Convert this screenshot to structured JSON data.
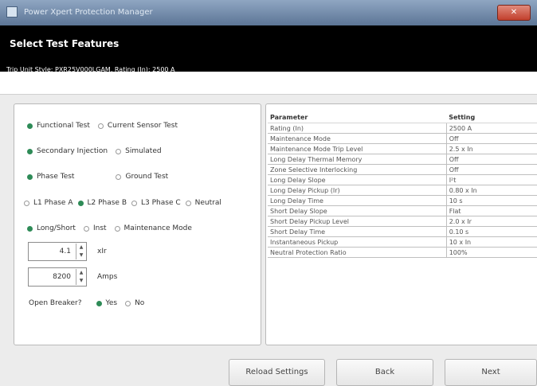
{
  "window": {
    "title": "Power Xpert Protection Manager",
    "close_glyph": "✕"
  },
  "header": {
    "title": "Select Test Features",
    "subtitle": "Trip Unit Style: PXR25V000LGAM, Rating (In): 2500 A"
  },
  "test_options": {
    "mode": {
      "options": [
        "Functional Test",
        "Current Sensor Test"
      ],
      "selected": "Functional Test"
    },
    "injection": {
      "options": [
        "Secondary Injection",
        "Simulated"
      ],
      "selected": "Secondary Injection"
    },
    "test_type": {
      "options": [
        "Phase Test",
        "Ground Test"
      ],
      "selected": "Phase Test"
    },
    "phase": {
      "options": [
        "L1 Phase A",
        "L2 Phase B",
        "L3 Phase C",
        "Neutral"
      ],
      "selected": "L2 Phase B"
    },
    "trip_type": {
      "options": [
        "Long/Short",
        "Inst",
        "Maintenance Mode"
      ],
      "selected": "Long/Short"
    },
    "multiplier": {
      "value": "4.1",
      "unit": "xIr"
    },
    "current": {
      "value": "8200",
      "unit": "Amps"
    },
    "open_breaker": {
      "label": "Open Breaker?",
      "options": [
        "Yes",
        "No"
      ],
      "selected": "Yes"
    }
  },
  "settings_table": {
    "columns": [
      "Parameter",
      "Setting"
    ],
    "rows": [
      [
        "Rating (In)",
        "2500 A"
      ],
      [
        "Maintenance Mode",
        "Off"
      ],
      [
        "Maintenance Mode Trip Level",
        "2.5 x In"
      ],
      [
        "Long Delay Thermal Memory",
        "Off"
      ],
      [
        "Zone Selective Interlocking",
        "Off"
      ],
      [
        "Long Delay Slope",
        "I²t"
      ],
      [
        "Long Delay Pickup (Ir)",
        "0.80 x In"
      ],
      [
        "Long Delay Time",
        "10 s"
      ],
      [
        "Short Delay Slope",
        "Flat"
      ],
      [
        "Short Delay Pickup Level",
        "2.0 x Ir"
      ],
      [
        "Short Delay Time",
        "0.10 s"
      ],
      [
        "Instantaneous Pickup",
        "10 x In"
      ],
      [
        "Neutral Protection Ratio",
        "100%"
      ]
    ]
  },
  "buttons": {
    "reload": "Reload Settings",
    "back": "Back",
    "next": "Next"
  }
}
